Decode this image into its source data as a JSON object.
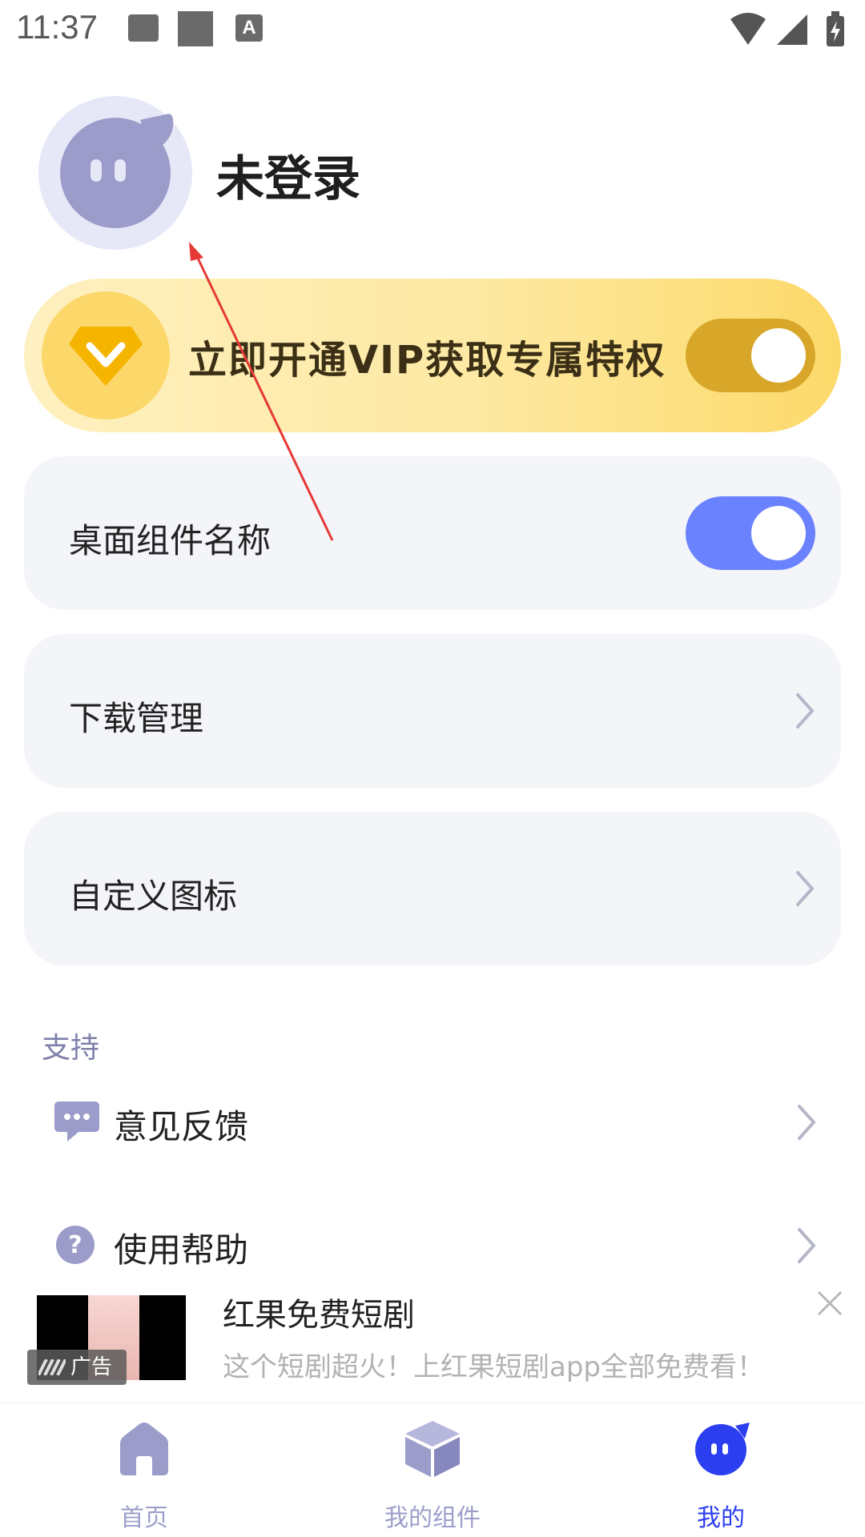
{
  "status_bar": {
    "time": "11:37",
    "icons": [
      "image-icon",
      "square-icon",
      "a-icon",
      "wifi-icon",
      "signal-icon",
      "battery-charging-icon"
    ]
  },
  "profile": {
    "name": "未登录"
  },
  "vip": {
    "text": "立即开通VIP获取专属特权",
    "toggle_on": true,
    "colors": {
      "toggle": "#d8a72a",
      "circle": "#fcd76a"
    }
  },
  "cards": [
    {
      "label": "桌面组件名称",
      "type": "toggle",
      "on": true
    },
    {
      "label": "下载管理",
      "type": "link"
    },
    {
      "label": "自定义图标",
      "type": "link"
    }
  ],
  "support": {
    "title": "支持",
    "items": [
      {
        "label": "意见反馈",
        "icon": "chat-bubble-icon"
      },
      {
        "label": "使用帮助",
        "icon": "help-circle-icon"
      }
    ]
  },
  "ad": {
    "title": "红果免费短剧",
    "description": "这个短剧超火！上红果短剧app全部免费看！",
    "badge": "广告"
  },
  "tabbar": {
    "tabs": [
      {
        "label": "首页",
        "icon": "home-icon",
        "active": false
      },
      {
        "label": "我的组件",
        "icon": "cube-icon",
        "active": false
      },
      {
        "label": "我的",
        "icon": "mascot-icon",
        "active": true
      }
    ]
  },
  "colors": {
    "accent": "#2b3ef0",
    "toggle_blue": "#6b82ff",
    "muted": "#9d9fcb",
    "card_bg": "#f4f5f9"
  }
}
